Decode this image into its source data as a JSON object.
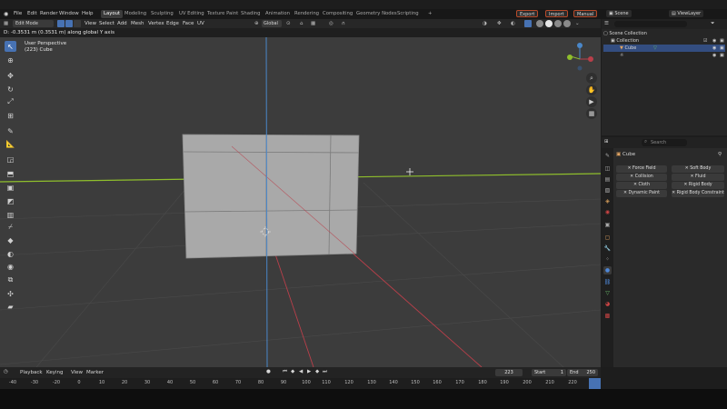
{
  "colors": {
    "viewport_bg": "#3c3c3c",
    "x_axis": "#b93f4a",
    "y_axis": "#8fbf2c",
    "z_axis": "#4a87c9",
    "cube_face": "#a9a9a9",
    "accent": "#4772b3"
  },
  "menu": {
    "file": "File",
    "edit": "Edit",
    "render": "Render",
    "window": "Window",
    "help": "Help"
  },
  "workspaces": [
    "Layout",
    "Modeling",
    "Sculpting",
    "UV Editing",
    "Texture Paint",
    "Shading",
    "Animation",
    "Rendering",
    "Compositing",
    "Geometry Nodes",
    "Scripting"
  ],
  "topright": {
    "export": "Export",
    "import": "Import",
    "manual": "Manual",
    "scene": "Scene",
    "view_layer": "ViewLayer"
  },
  "header": {
    "mode": "Edit Mode",
    "view": "View",
    "select": "Select",
    "add": "Add",
    "mesh": "Mesh",
    "vertex": "Vertex",
    "edge": "Edge",
    "face": "Face",
    "uv": "UV",
    "orientation": "Global"
  },
  "status_line": "D: -0.3531 m (0.3531 m) along global Y axis",
  "viewport_info": {
    "perspective": "User Perspective",
    "object": "(223) Cube"
  },
  "tools": [
    "select",
    "cursor",
    "move",
    "rotate",
    "scale",
    "transform",
    "annotate",
    "measure",
    "add-cube",
    "extrude",
    "inset",
    "bevel",
    "loop-cut",
    "knife",
    "poly-build",
    "spin",
    "smooth",
    "edge-slide",
    "shrink-fatten",
    "shear",
    "rip"
  ],
  "outliner": {
    "search_placeholder": "",
    "scene_collection": "Scene Collection",
    "collection": "Collection",
    "cube": "Cube",
    "light": "",
    "camera": ""
  },
  "properties": {
    "search_placeholder": "Search",
    "object": "Cube",
    "physics_buttons": [
      [
        "Force Field",
        "Soft Body"
      ],
      [
        "Collision",
        "Fluid"
      ],
      [
        "Cloth",
        "Rigid Body"
      ],
      [
        "Dynamic Paint",
        "Rigid Body Constraint"
      ]
    ],
    "tabs": [
      "tool",
      "render",
      "output",
      "view-layer",
      "scene",
      "world",
      "collection",
      "object",
      "modifiers",
      "particles",
      "physics",
      "constraints",
      "data",
      "material",
      "texture"
    ]
  },
  "timeline": {
    "playback": "Playback",
    "keying": "Keying",
    "view": "View",
    "marker": "Marker",
    "current_frame": "223",
    "start_label": "Start",
    "start": "1",
    "end_label": "End",
    "end": "250"
  },
  "ruler_ticks": [
    "-40",
    "-20",
    "0",
    "10",
    "20",
    "30",
    "40",
    "50",
    "60",
    "70",
    "80",
    "90",
    "100",
    "110",
    "120",
    "130",
    "140",
    "150",
    "160",
    "170",
    "180",
    "190",
    "200",
    "210",
    "220"
  ],
  "ruler_extra": "-30"
}
